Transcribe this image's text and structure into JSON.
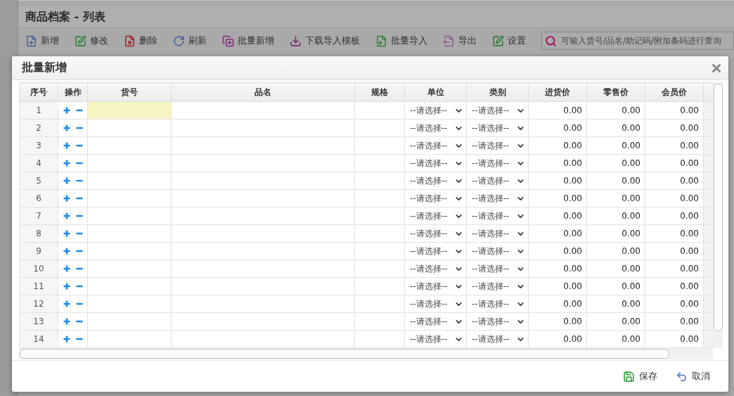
{
  "page": {
    "title": "商品档案 - 列表",
    "toolbar": [
      {
        "label": "新增",
        "kind": "add"
      },
      {
        "label": "修改",
        "kind": "edit"
      },
      {
        "label": "删除",
        "kind": "delete"
      },
      {
        "label": "刷新",
        "kind": "refresh"
      },
      {
        "label": "批量新增",
        "kind": "batch"
      },
      {
        "label": "下载导入模板",
        "kind": "download"
      },
      {
        "label": "批量导入",
        "kind": "import"
      },
      {
        "label": "导出",
        "kind": "export"
      },
      {
        "label": "设置",
        "kind": "settings"
      }
    ],
    "search": {
      "placeholder": "可输入货号/品名/助记码/附加条码进行查询"
    }
  },
  "dialog": {
    "title": "批量新增",
    "columns": [
      "序号",
      "操作",
      "货号",
      "品名",
      "规格",
      "单位",
      "类别",
      "进货价",
      "零售价",
      "会员价"
    ],
    "rows": [
      {
        "no": "1",
        "focused": true,
        "unit": "--请选择--",
        "category": "--请选择--",
        "purchase_price": "0.00",
        "retail_price": "0.00",
        "member_price": "0.00"
      },
      {
        "no": "2",
        "focused": false,
        "unit": "--请选择--",
        "category": "--请选择--",
        "purchase_price": "0.00",
        "retail_price": "0.00",
        "member_price": "0.00"
      },
      {
        "no": "3",
        "focused": false,
        "unit": "--请选择--",
        "category": "--请选择--",
        "purchase_price": "0.00",
        "retail_price": "0.00",
        "member_price": "0.00"
      },
      {
        "no": "4",
        "focused": false,
        "unit": "--请选择--",
        "category": "--请选择--",
        "purchase_price": "0.00",
        "retail_price": "0.00",
        "member_price": "0.00"
      },
      {
        "no": "5",
        "focused": false,
        "unit": "--请选择--",
        "category": "--请选择--",
        "purchase_price": "0.00",
        "retail_price": "0.00",
        "member_price": "0.00"
      },
      {
        "no": "6",
        "focused": false,
        "unit": "--请选择--",
        "category": "--请选择--",
        "purchase_price": "0.00",
        "retail_price": "0.00",
        "member_price": "0.00"
      },
      {
        "no": "7",
        "focused": false,
        "unit": "--请选择--",
        "category": "--请选择--",
        "purchase_price": "0.00",
        "retail_price": "0.00",
        "member_price": "0.00"
      },
      {
        "no": "8",
        "focused": false,
        "unit": "--请选择--",
        "category": "--请选择--",
        "purchase_price": "0.00",
        "retail_price": "0.00",
        "member_price": "0.00"
      },
      {
        "no": "9",
        "focused": false,
        "unit": "--请选择--",
        "category": "--请选择--",
        "purchase_price": "0.00",
        "retail_price": "0.00",
        "member_price": "0.00"
      },
      {
        "no": "10",
        "focused": false,
        "unit": "--请选择--",
        "category": "--请选择--",
        "purchase_price": "0.00",
        "retail_price": "0.00",
        "member_price": "0.00"
      },
      {
        "no": "11",
        "focused": false,
        "unit": "--请选择--",
        "category": "--请选择--",
        "purchase_price": "0.00",
        "retail_price": "0.00",
        "member_price": "0.00"
      },
      {
        "no": "12",
        "focused": false,
        "unit": "--请选择--",
        "category": "--请选择--",
        "purchase_price": "0.00",
        "retail_price": "0.00",
        "member_price": "0.00"
      },
      {
        "no": "13",
        "focused": false,
        "unit": "--请选择--",
        "category": "--请选择--",
        "purchase_price": "0.00",
        "retail_price": "0.00",
        "member_price": "0.00"
      },
      {
        "no": "14",
        "focused": false,
        "unit": "--请选择--",
        "category": "--请选择--",
        "purchase_price": "0.00",
        "retail_price": "0.00",
        "member_price": "0.00"
      }
    ],
    "buttons": [
      {
        "label": "保存",
        "kind": "save"
      },
      {
        "label": "取消",
        "kind": "cancel"
      }
    ]
  }
}
